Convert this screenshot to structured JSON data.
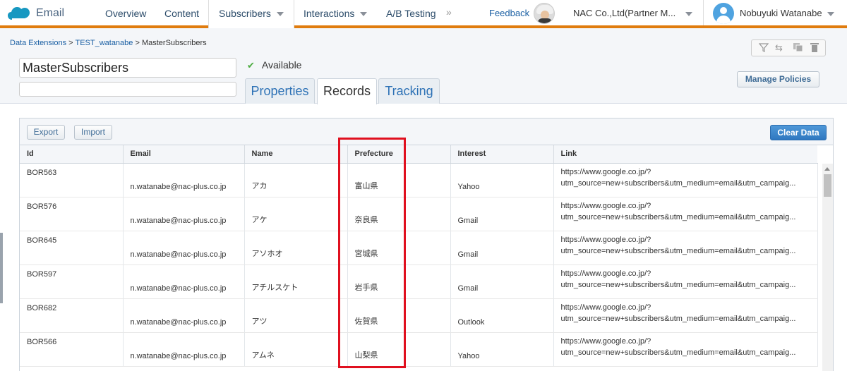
{
  "nav": {
    "app_name": "Email",
    "items": [
      {
        "label": "Overview"
      },
      {
        "label": "Content"
      },
      {
        "label": "Subscribers"
      },
      {
        "label": "Interactions"
      },
      {
        "label": "A/B Testing"
      }
    ],
    "more": "»",
    "feedback": "Feedback",
    "org": "NAC Co.,Ltd(Partner M...",
    "user": "Nobuyuki Watanabe",
    "accent_color": "#e07c0e"
  },
  "breadcrumb": {
    "root": "Data Extensions",
    "folder": "TEST_watanabe",
    "current": "MasterSubscribers",
    "sep": ">"
  },
  "extension": {
    "name": "MasterSubscribers",
    "description": "",
    "status": "Available"
  },
  "tabs": [
    {
      "label": "Properties"
    },
    {
      "label": "Records"
    },
    {
      "label": "Tracking"
    }
  ],
  "buttons": {
    "manage_policies": "Manage Policies",
    "export": "Export",
    "import": "Import",
    "clear_data": "Clear Data"
  },
  "table": {
    "columns": [
      "Id",
      "Email",
      "Name",
      "Prefecture",
      "Interest",
      "Link"
    ],
    "rows": [
      {
        "id": "BOR563",
        "email": "n.watanabe@nac-plus.co.jp",
        "name": "アカ",
        "prefecture": "富山県",
        "interest": "Yahoo",
        "link1": "https://www.google.co.jp/?",
        "link2": "utm_source=new+subscribers&utm_medium=email&utm_campaig..."
      },
      {
        "id": "BOR576",
        "email": "n.watanabe@nac-plus.co.jp",
        "name": "アケ",
        "prefecture": "奈良県",
        "interest": "Gmail",
        "link1": "https://www.google.co.jp/?",
        "link2": "utm_source=new+subscribers&utm_medium=email&utm_campaig..."
      },
      {
        "id": "BOR645",
        "email": "n.watanabe@nac-plus.co.jp",
        "name": "アソホオ",
        "prefecture": "宮城県",
        "interest": "Gmail",
        "link1": "https://www.google.co.jp/?",
        "link2": "utm_source=new+subscribers&utm_medium=email&utm_campaig..."
      },
      {
        "id": "BOR597",
        "email": "n.watanabe@nac-plus.co.jp",
        "name": "アチルスケト",
        "prefecture": "岩手県",
        "interest": "Gmail",
        "link1": "https://www.google.co.jp/?",
        "link2": "utm_source=new+subscribers&utm_medium=email&utm_campaig..."
      },
      {
        "id": "BOR682",
        "email": "n.watanabe@nac-plus.co.jp",
        "name": "アツ",
        "prefecture": "佐賀県",
        "interest": "Outlook",
        "link1": "https://www.google.co.jp/?",
        "link2": "utm_source=new+subscribers&utm_medium=email&utm_campaig..."
      },
      {
        "id": "BOR566",
        "email": "n.watanabe@nac-plus.co.jp",
        "name": "アムネ",
        "prefecture": "山梨県",
        "interest": "Yahoo",
        "link1": "https://www.google.co.jp/?",
        "link2": "utm_source=new+subscribers&utm_medium=email&utm_campaig..."
      }
    ]
  },
  "icons": {
    "filter": "filter-icon",
    "move": "move-icon",
    "copy": "copy-icon",
    "delete": "trash-icon"
  }
}
